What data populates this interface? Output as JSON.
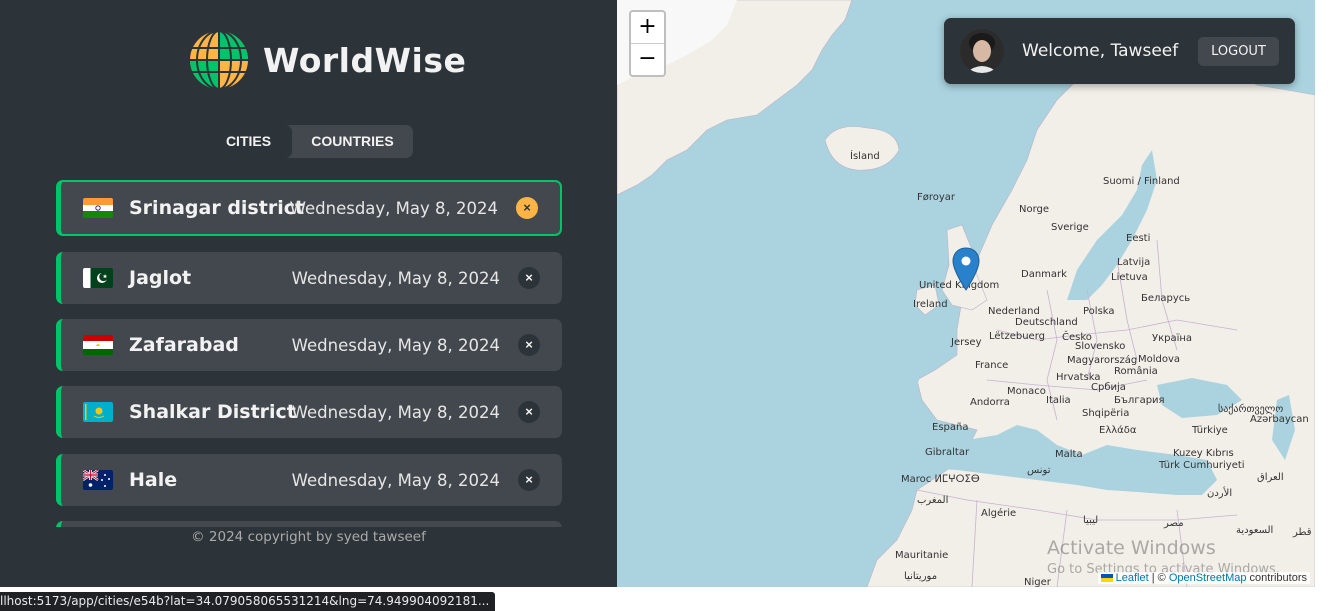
{
  "app": {
    "logo_text": "WorldWise",
    "footer": "© 2024 copyright by syed tawseef"
  },
  "tabs": [
    {
      "label": "CITIES",
      "active": true
    },
    {
      "label": "COUNTRIES",
      "active": false
    }
  ],
  "cities": [
    {
      "name": "Srinagar district",
      "date": "Wednesday, May 8, 2024",
      "flag": "india-flag-icon",
      "active": true
    },
    {
      "name": "Jaglot",
      "date": "Wednesday, May 8, 2024",
      "flag": "pakistan-flag-icon",
      "active": false
    },
    {
      "name": "Zafarabad",
      "date": "Wednesday, May 8, 2024",
      "flag": "tajikistan-flag-icon",
      "active": false
    },
    {
      "name": "Shalkar District",
      "date": "Wednesday, May 8, 2024",
      "flag": "kazakhstan-flag-icon",
      "active": false
    },
    {
      "name": "Hale",
      "date": "Wednesday, May 8, 2024",
      "flag": "australia-flag-icon",
      "active": false
    }
  ],
  "delete_symbol": "×",
  "map": {
    "zoom_in": "+",
    "zoom_out": "−",
    "labels": {
      "island": "Ísland",
      "faroe": "Føroyar",
      "finland": "Suomi / Finland",
      "norge": "Norge",
      "sverige": "Sverige",
      "eesti": "Eesti",
      "latvija": "Latvija",
      "lietuva": "Lietuva",
      "danmark": "Danmark",
      "uk": "United Kingdom",
      "ireland": "Ireland",
      "belarus": "Беларусь",
      "nederland": "Nederland",
      "polska": "Polska",
      "deutschland": "Deutschland",
      "letzebuerg": "Lëtzebuerg",
      "cesko": "Česko",
      "ukraina": "Україна",
      "slovensko": "Slovensko",
      "jersey": "Jersey",
      "magyar": "Magyarország",
      "moldova": "Moldova",
      "france": "France",
      "romania": "România",
      "hrvatska": "Hrvatska",
      "monaco": "Monaco",
      "srbija": "Србија",
      "andorra": "Andorra",
      "italia": "Italia",
      "bulgaria": "България",
      "shqiperia": "Shqipëria",
      "georgia": "საქართველო",
      "azerbaycan": "Azərbaycan",
      "espana": "España",
      "ellada": "Ελλάδα",
      "turkiye": "Türkiye",
      "gibraltar": "Gibraltar",
      "malta": "Malta",
      "kuzey": "Kuzey Kıbrıs",
      "turk": "Türk Cumhuriyeti",
      "iraq": "العراق",
      "tunis": "تونس",
      "maroc": "Maroc ⵍⵎⵖⵔⵉⴱ",
      "maghrib": "المغرب",
      "urdun": "الأردن",
      "algerie": "Algérie",
      "libya": "ليبيا",
      "misr": "مصر",
      "saudi": "السعودية",
      "qatar": "قطر",
      "mauritanie": "Mauritanie",
      "mauritaniya": "موريتانيا",
      "niger": "Niger"
    },
    "attribution": {
      "leaflet": "Leaflet",
      "sep": " | © ",
      "osm": "OpenStreetMap",
      "suffix": " contributors"
    }
  },
  "user": {
    "welcome": "Welcome, Tawseef",
    "logout": "LOGOUT"
  },
  "watermark": {
    "line1": "Activate Windows",
    "line2": "Go to Settings to activate Windows."
  },
  "status_url": "llhost:5173/app/cities/e54b?lat=34.079058065531214&lng=74.949904092181..."
}
